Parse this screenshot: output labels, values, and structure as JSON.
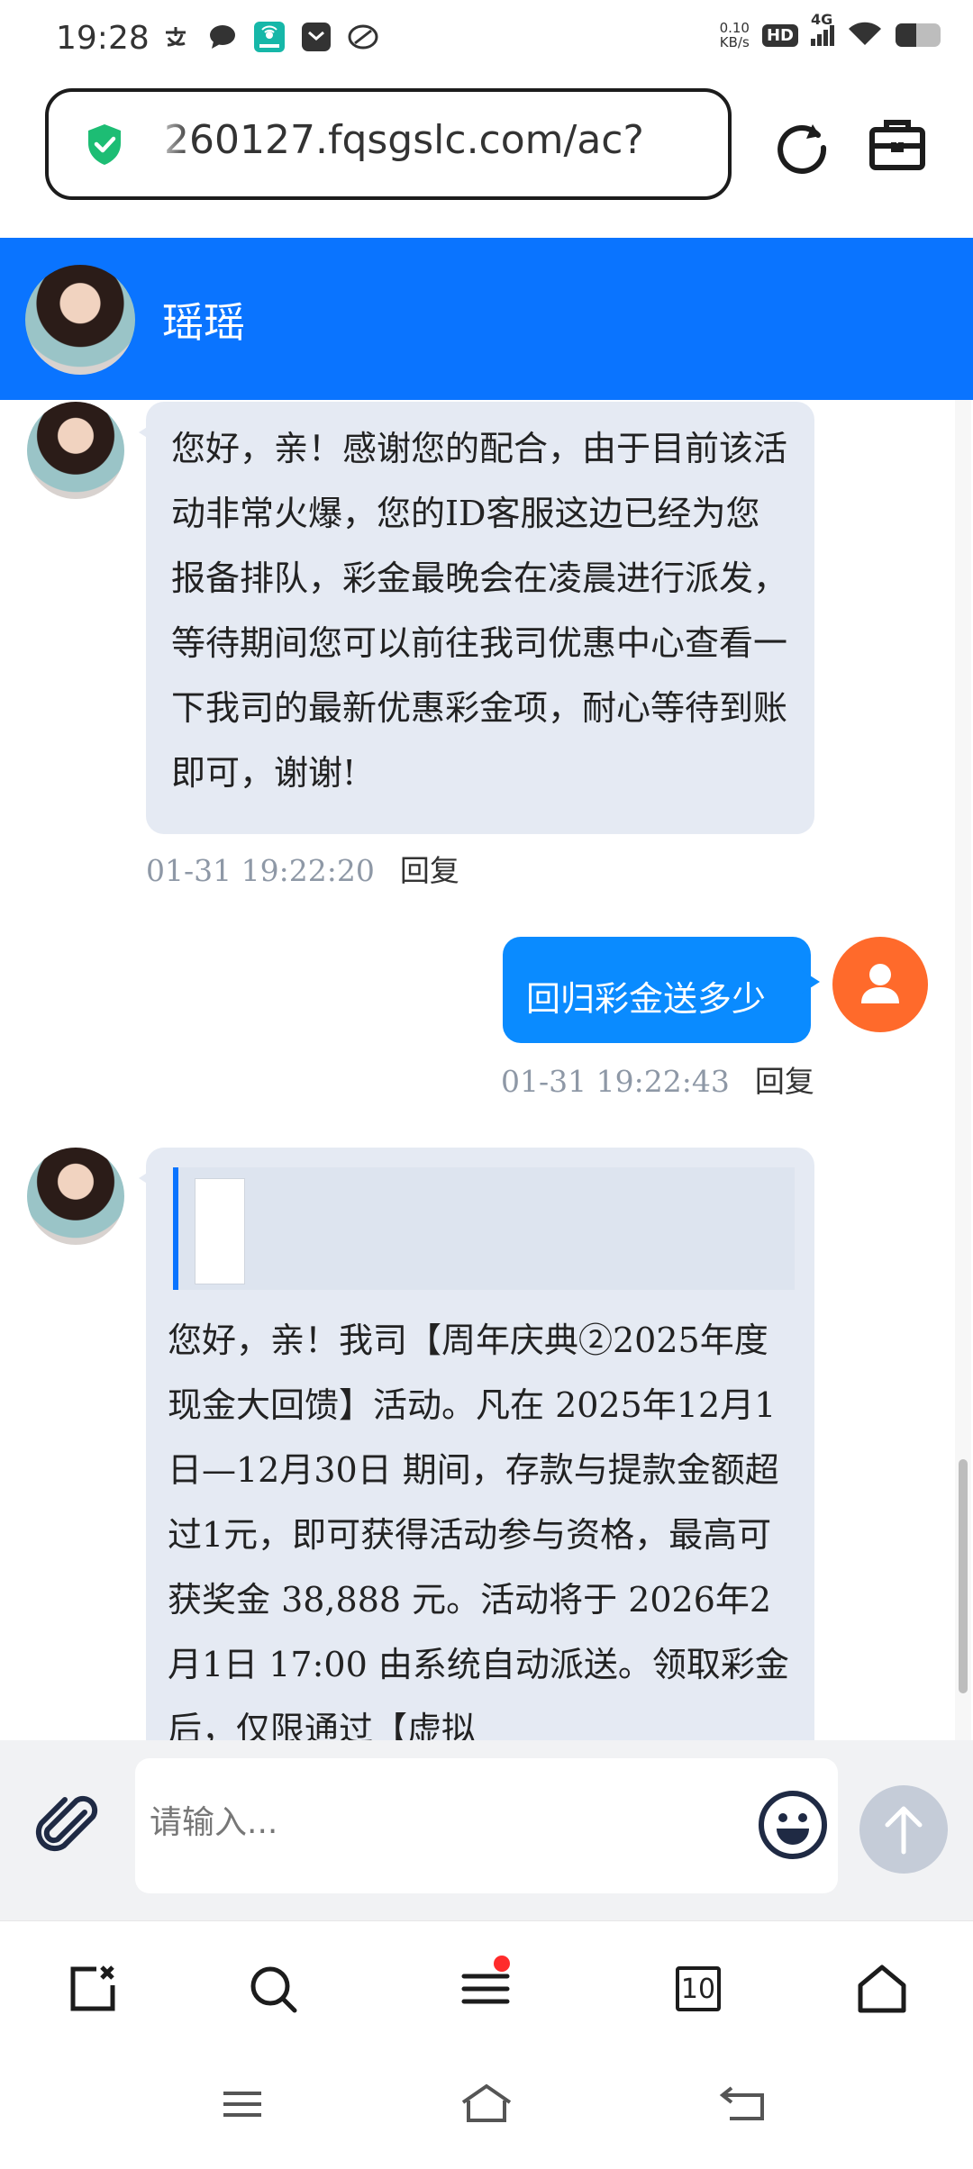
{
  "status_bar": {
    "time": "19:28",
    "speed_value": "0.10",
    "speed_unit": "KB/s",
    "hd_label": "HD",
    "network_label": "4G",
    "battery_level": 0.45,
    "left_icons": [
      "alipay-icon",
      "message-icon",
      "wifi-scan-app-icon",
      "mail-app-icon",
      "feather-app-icon"
    ]
  },
  "browser": {
    "url": "260127.fqsgslc.com/ac?",
    "tab_count": "10",
    "icons": [
      "security-shield-icon",
      "reload-icon",
      "toolbox-icon"
    ]
  },
  "chat_header": {
    "name": "瑶瑶"
  },
  "messages": [
    {
      "sender": "agent",
      "text": "您好，亲！感谢您的配合，由于目前该活动非常火爆，您的ID客服这边已经为您报备排队，彩金最晚会在凌晨进行派发，等待期间您可以前往我司优惠中心查看一下我司的最新优惠彩金项，耐心等待到账即可，谢谢!",
      "time": "01-31 19:22:20",
      "reply": "回复"
    },
    {
      "sender": "user",
      "text": "回归彩金送多少",
      "time": "01-31 19:22:43",
      "reply": "回复"
    },
    {
      "sender": "agent",
      "has_quote_image": true,
      "text": "您好，亲！我司【周年庆典②2025年度现金大回馈】活动。凡在 2025年12月1日—12月30日 期间，存款与提款金额超过1元，即可获得活动参与资格，最高可获奖金 38,888 元。活动将于 2026年2月1日 17:00 由系统自动派送。领取彩金后，仅限通过【虚拟"
    }
  ],
  "input": {
    "placeholder": "请输入..."
  },
  "colors": {
    "header_blue": "#0a74ff",
    "bubble_out": "#0a8bff",
    "bubble_in": "#e5eaf3",
    "user_avatar": "#ff6a2b",
    "send_disabled": "#c5ccd8",
    "notification_dot": "#ff2b2b"
  }
}
